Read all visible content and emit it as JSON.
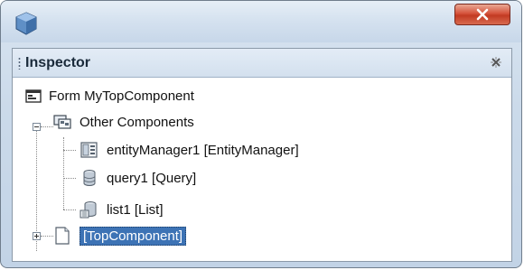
{
  "window": {
    "app_icon": "cube-icon",
    "close_icon": "close-x-icon"
  },
  "panel": {
    "title": "Inspector",
    "grip_icon": "drag-grip-icon",
    "close_icon": "panel-close-icon"
  },
  "tree": {
    "root": {
      "label": "Form MyTopComponent",
      "icon": "form-icon"
    },
    "other_components": {
      "label": "Other Components",
      "icon": "components-folder-icon",
      "expanded": true,
      "children": [
        {
          "label": "entityManager1 [EntityManager]",
          "icon": "entity-manager-icon"
        },
        {
          "label": "query1 [Query]",
          "icon": "query-database-icon"
        },
        {
          "label": "list1 [List]",
          "icon": "list-database-icon"
        }
      ]
    },
    "top_component": {
      "label": "[TopComponent]",
      "icon": "document-icon",
      "expanded": false,
      "selected": true
    }
  }
}
